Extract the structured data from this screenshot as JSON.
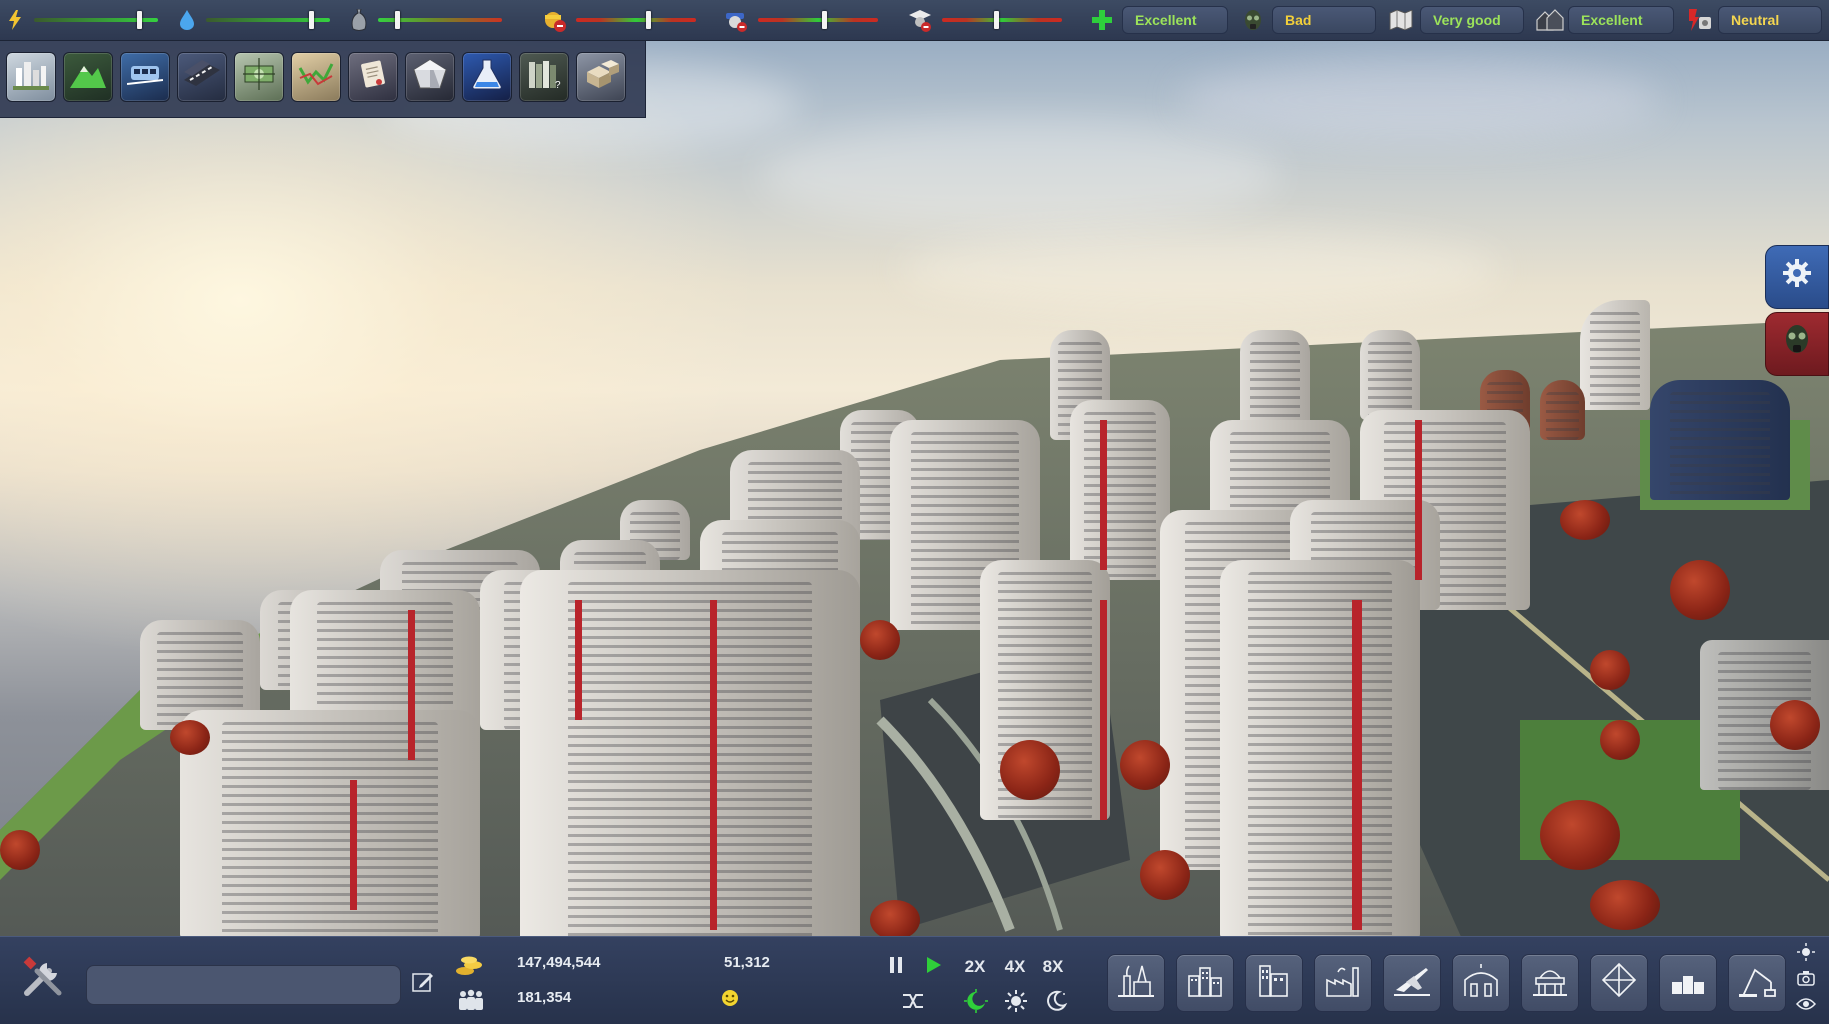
{
  "top_bar": {
    "power": {
      "icon": "lightning-icon",
      "level": 0.85
    },
    "water": {
      "icon": "water-drop-icon",
      "level": 0.85
    },
    "waste": {
      "icon": "garbage-bag-icon",
      "level": 0.15
    },
    "fire": {
      "icon": "firefighter-icon",
      "level": 0.6
    },
    "police": {
      "icon": "police-icon",
      "level": 0.55
    },
    "education": {
      "icon": "graduate-icon",
      "level": 0.45
    },
    "status": [
      {
        "key": "health",
        "icon": "medical-cross-icon",
        "label": "Excellent",
        "color": "#9ce35a"
      },
      {
        "key": "pollution",
        "icon": "gas-mask-icon",
        "label": "Bad",
        "color": "#f2cf3a"
      },
      {
        "key": "tourism",
        "icon": "map-icon",
        "label": "Very good",
        "color": "#9ce35a"
      },
      {
        "key": "housing",
        "icon": "houses-icon",
        "label": "Excellent",
        "color": "#9ce35a"
      },
      {
        "key": "crime",
        "icon": "crime-icon",
        "label": "Neutral",
        "color": "#f4d650"
      }
    ]
  },
  "category_toolbar": [
    {
      "key": "city-overview",
      "icon": "city-overview-icon"
    },
    {
      "key": "terrain",
      "icon": "terrain-icon"
    },
    {
      "key": "transport",
      "icon": "transport-icon"
    },
    {
      "key": "roads",
      "icon": "roads-icon"
    },
    {
      "key": "finance",
      "icon": "finance-icon"
    },
    {
      "key": "graphs",
      "icon": "graph-icon"
    },
    {
      "key": "policies",
      "icon": "scroll-icon"
    },
    {
      "key": "resources",
      "icon": "gem-icon"
    },
    {
      "key": "research",
      "icon": "flask-icon"
    },
    {
      "key": "library",
      "icon": "books-icon"
    },
    {
      "key": "storage",
      "icon": "crates-icon"
    }
  ],
  "side_buttons": [
    {
      "key": "settings",
      "icon": "gear-icon"
    },
    {
      "key": "disaster",
      "icon": "gas-mask-icon"
    }
  ],
  "bottom_bar": {
    "city_name": {
      "value": "",
      "placeholder": ""
    },
    "money": "147,494,544",
    "population": "181,354",
    "income": "51,312",
    "happiness_icon": "smiley-icon",
    "speeds": [
      "2X",
      "4X",
      "8X"
    ],
    "build_categories": [
      {
        "key": "power-plant",
        "icon": "power-plant-icon"
      },
      {
        "key": "residential",
        "icon": "residential-icon"
      },
      {
        "key": "commercial",
        "icon": "commercial-icon"
      },
      {
        "key": "industrial",
        "icon": "industrial-icon"
      },
      {
        "key": "airport",
        "icon": "airport-icon"
      },
      {
        "key": "services",
        "icon": "services-icon"
      },
      {
        "key": "landmarks",
        "icon": "landmark-icon"
      },
      {
        "key": "parks",
        "icon": "pyramid-icon"
      },
      {
        "key": "storage",
        "icon": "warehouse-icon"
      },
      {
        "key": "bulldoze",
        "icon": "crane-icon"
      }
    ]
  }
}
